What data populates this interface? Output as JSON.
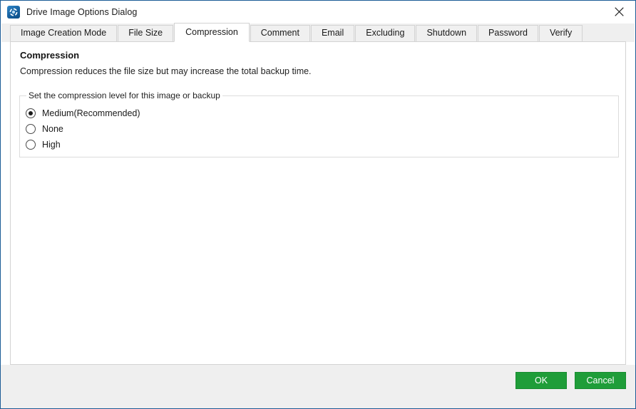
{
  "window": {
    "title": "Drive Image Options Dialog",
    "app_icon": "drive-image-icon",
    "close_icon": "close-icon"
  },
  "tabs": [
    {
      "label": "Image Creation Mode",
      "selected": false
    },
    {
      "label": "File Size",
      "selected": false
    },
    {
      "label": "Compression",
      "selected": true
    },
    {
      "label": "Comment",
      "selected": false
    },
    {
      "label": "Email",
      "selected": false
    },
    {
      "label": "Excluding",
      "selected": false
    },
    {
      "label": "Shutdown",
      "selected": false
    },
    {
      "label": "Password",
      "selected": false
    },
    {
      "label": "Verify",
      "selected": false
    }
  ],
  "page": {
    "heading": "Compression",
    "description": "Compression reduces the file size but may increase the total backup time.",
    "groupbox": {
      "legend": "Set the compression level for this image or backup",
      "options": [
        {
          "label": "Medium(Recommended)",
          "selected": true
        },
        {
          "label": "None",
          "selected": false
        },
        {
          "label": "High",
          "selected": false
        }
      ]
    }
  },
  "footer": {
    "ok_label": "OK",
    "cancel_label": "Cancel"
  },
  "colors": {
    "accent_button": "#1f9d39",
    "window_border": "#1c5c96",
    "panel_border": "#d3d3d3",
    "footer_bg": "#efefef"
  }
}
